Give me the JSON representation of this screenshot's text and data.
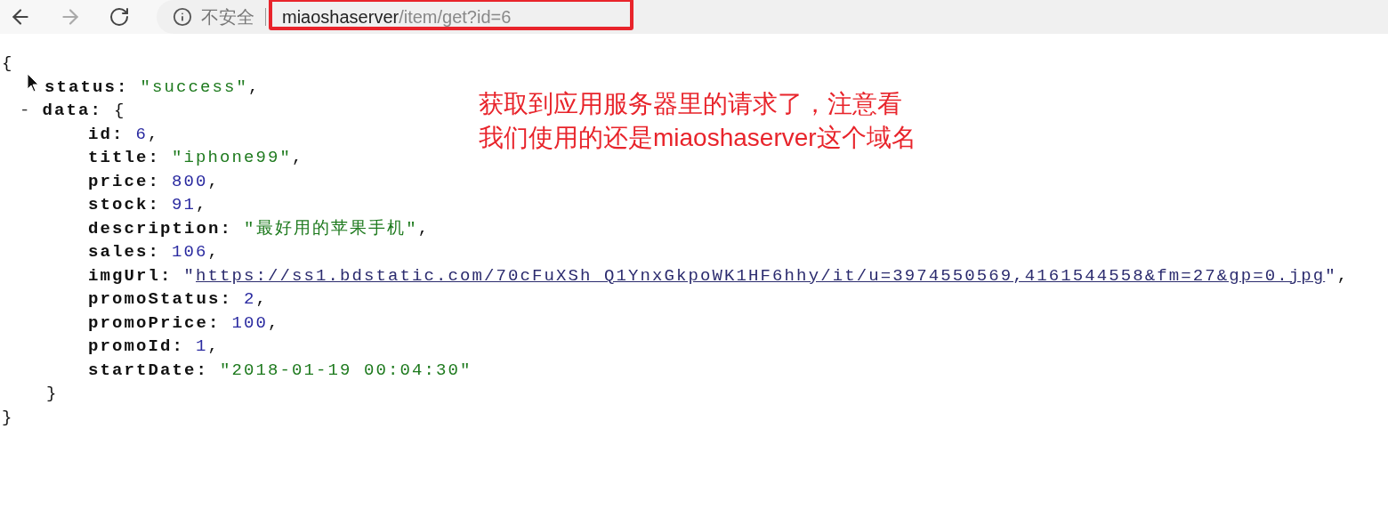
{
  "toolbar": {
    "back_enabled": true,
    "forward_enabled": false
  },
  "address_bar": {
    "security_label": "不安全",
    "url_host": "miaoshaserver",
    "url_path": "/item/get?id=6",
    "highlighted": true
  },
  "json_view": {
    "open": "{",
    "close": "}",
    "entries": [
      {
        "key": "status:",
        "value": "\"success\"",
        "kind": "string",
        "suffix": ","
      },
      {
        "key": "data:",
        "toggle": "-",
        "open": "{",
        "close": "}",
        "children": [
          {
            "key": "id:",
            "value": "6",
            "kind": "number",
            "suffix": ","
          },
          {
            "key": "title:",
            "value": "\"iphone99\"",
            "kind": "string",
            "suffix": ","
          },
          {
            "key": "price:",
            "value": "800",
            "kind": "number",
            "suffix": ","
          },
          {
            "key": "stock:",
            "value": "91",
            "kind": "number",
            "suffix": ","
          },
          {
            "key": "description:",
            "value": "\"最好用的苹果手机\"",
            "kind": "string",
            "suffix": ","
          },
          {
            "key": "sales:",
            "value": "106",
            "kind": "number",
            "suffix": ","
          },
          {
            "key": "imgUrl:",
            "open_quote": "\"",
            "value": "https://ss1.bdstatic.com/70cFuXSh_Q1YnxGkpoWK1HF6hhy/it/u=3974550569,4161544558&fm=27&gp=0.jpg",
            "close_quote": "\"",
            "kind": "link",
            "suffix": ","
          },
          {
            "key": "promoStatus:",
            "value": "2",
            "kind": "number",
            "suffix": ","
          },
          {
            "key": "promoPrice:",
            "value": "100",
            "kind": "number",
            "suffix": ","
          },
          {
            "key": "promoId:",
            "value": "1",
            "kind": "number",
            "suffix": ","
          },
          {
            "key": "startDate:",
            "value": "\"2018-01-19 00:04:30\"",
            "kind": "string"
          }
        ]
      }
    ]
  },
  "annotation": {
    "lines": [
      "获取到应用服务器里的请求了，注意看",
      "我们使用的还是miaoshaserver这个域名"
    ]
  }
}
